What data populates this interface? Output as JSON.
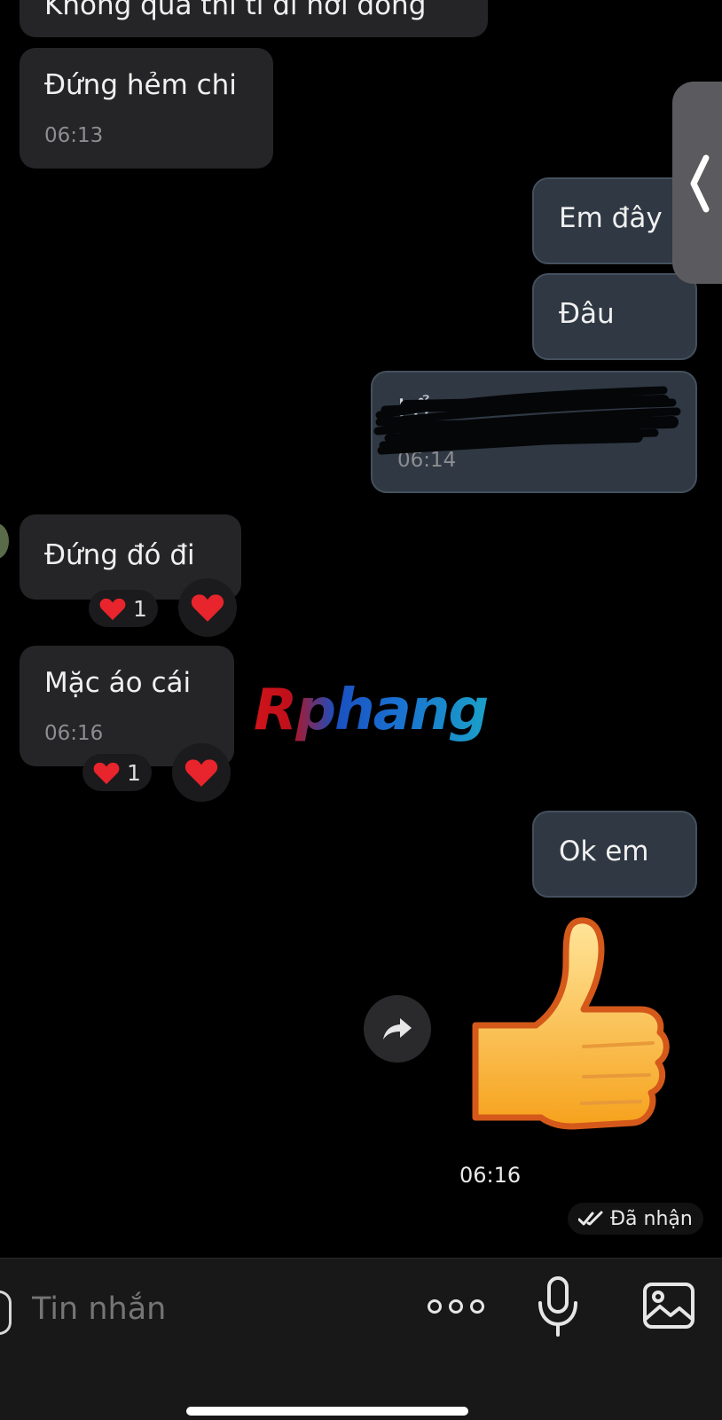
{
  "messages": {
    "m0": {
      "text": "Không quá thì tí đi nơi đông"
    },
    "m1": {
      "text": "Đứng hẻm chi",
      "time": "06:13"
    },
    "m2": {
      "text": "Em đây"
    },
    "m3": {
      "text": "Đâu"
    },
    "m4": {
      "text": "Lổ",
      "time": "06:14"
    },
    "m5": {
      "text": "Đứng đó đi",
      "reaction": {
        "icon": "heart",
        "count": "1"
      }
    },
    "m6": {
      "text": "Mặc áo cái",
      "time": "06:16",
      "reaction": {
        "icon": "heart",
        "count": "1"
      }
    },
    "m7": {
      "text": "Ok em"
    },
    "m8": {
      "sticker": "thumbs-up",
      "time": "06:16"
    }
  },
  "status": {
    "delivered": "Đã nhận"
  },
  "watermark": "Rphang",
  "composer": {
    "placeholder": "Tin nhắn"
  },
  "colors": {
    "incoming": "#252527",
    "outgoing": "#2f3843",
    "background": "#000000",
    "heart": "#e8242c"
  }
}
